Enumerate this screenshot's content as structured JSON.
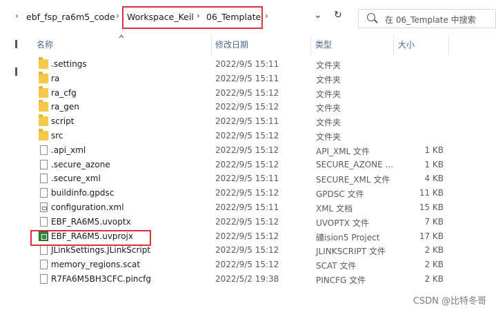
{
  "address_bar": {
    "crumbs": [
      "ebf_fsp_ra6m5_code",
      "Workspace_Keil",
      "06_Template"
    ],
    "search_placeholder": "在 06_Template 中搜索",
    "highlight_color": "#d9323a"
  },
  "columns": {
    "name": "名称",
    "date": "修改日期",
    "type": "类型",
    "size": "大小"
  },
  "files": [
    {
      "name": ".settings",
      "date": "2022/9/5 15:11",
      "type": "文件夹",
      "size": "",
      "icon": "folder-icon"
    },
    {
      "name": "ra",
      "date": "2022/9/5 15:11",
      "type": "文件夹",
      "size": "",
      "icon": "folder-icon"
    },
    {
      "name": "ra_cfg",
      "date": "2022/9/5 15:12",
      "type": "文件夹",
      "size": "",
      "icon": "folder-icon"
    },
    {
      "name": "ra_gen",
      "date": "2022/9/5 15:12",
      "type": "文件夹",
      "size": "",
      "icon": "folder-icon"
    },
    {
      "name": "script",
      "date": "2022/9/5 15:11",
      "type": "文件夹",
      "size": "",
      "icon": "folder-icon"
    },
    {
      "name": "src",
      "date": "2022/9/5 15:12",
      "type": "文件夹",
      "size": "",
      "icon": "folder-icon"
    },
    {
      "name": ".api_xml",
      "date": "2022/9/5 15:12",
      "type": "API_XML 文件",
      "size": "1 KB",
      "icon": "file-icon"
    },
    {
      "name": ".secure_azone",
      "date": "2022/9/5 15:12",
      "type": "SECURE_AZONE ...",
      "size": "1 KB",
      "icon": "file-icon"
    },
    {
      "name": ".secure_xml",
      "date": "2022/9/5 15:11",
      "type": "SECURE_XML 文件",
      "size": "4 KB",
      "icon": "file-icon"
    },
    {
      "name": "buildinfo.gpdsc",
      "date": "2022/9/5 15:12",
      "type": "GPDSC 文件",
      "size": "11 KB",
      "icon": "file-icon"
    },
    {
      "name": "configuration.xml",
      "date": "2022/9/5 15:11",
      "type": "XML 文档",
      "size": "15 KB",
      "icon": "xml-file-icon"
    },
    {
      "name": "EBF_RA6M5.uvoptx",
      "date": "2022/9/5 15:12",
      "type": "UVOPTX 文件",
      "size": "7 KB",
      "icon": "file-icon"
    },
    {
      "name": "EBF_RA6M5.uvprojx",
      "date": "2022/9/5 15:12",
      "type": "礦ision5 Project",
      "size": "17 KB",
      "icon": "keil-project-icon",
      "highlighted": true
    },
    {
      "name": "JLinkSettings.JLinkScript",
      "date": "2022/9/5 15:12",
      "type": "JLINKSCRIPT 文件",
      "size": "2 KB",
      "icon": "file-icon"
    },
    {
      "name": "memory_regions.scat",
      "date": "2022/9/5 15:12",
      "type": "SCAT 文件",
      "size": "2 KB",
      "icon": "file-icon"
    },
    {
      "name": "R7FA6M5BH3CFC.pincfg",
      "date": "2022/5/2 19:38",
      "type": "PINCFG 文件",
      "size": "2 KB",
      "icon": "file-icon"
    }
  ],
  "watermark": "CSDN @比特冬哥"
}
